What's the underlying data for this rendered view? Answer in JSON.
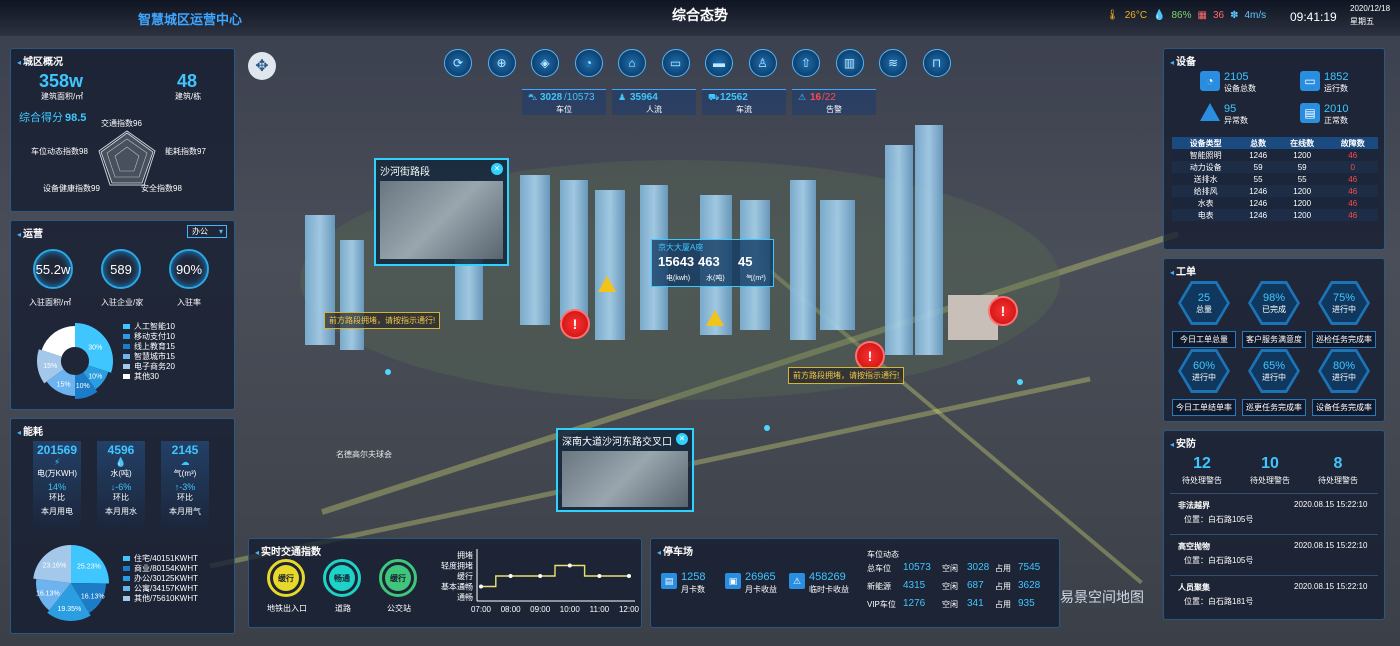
{
  "header": {
    "brand": "智慧城区运营中心",
    "title": "综合态势",
    "temperature": "26°C",
    "humidity": "86%",
    "pm": "36",
    "wind": "4m/s",
    "time": "09:41:19",
    "date": "2020/12/18",
    "weekday": "星期五"
  },
  "overview": {
    "title": "城区概况",
    "area_value": "358w",
    "area_label": "建筑面积/㎡",
    "bldg_value": "48",
    "bldg_label": "建筑/栋",
    "score_label": "综合得分",
    "score_value": "98.5",
    "radar": [
      "交通指数96",
      "能耗指数97",
      "安全指数98",
      "设备健康指数99",
      "车位动态指数98"
    ]
  },
  "ops": {
    "title": "运营",
    "select": "办公",
    "c1": "55.2w",
    "c1_label": "入驻面积/㎡",
    "c2": "589",
    "c2_label": "入驻企业/家",
    "c3": "90%",
    "c3_label": "入驻率",
    "pie_labels": [
      "30%",
      "10%",
      "10%",
      "15%",
      "15%",
      "20%"
    ],
    "legend": [
      "人工智能10",
      "移动支付10",
      "线上教育15",
      "智慧城市15",
      "电子商务20",
      "其他30"
    ],
    "legend_colors": [
      "#3fc6ff",
      "#2a9ee0",
      "#1c7cc8",
      "#6db3ef",
      "#a4c8ea",
      "#ffffff"
    ]
  },
  "energy": {
    "title": "能耗",
    "items": [
      {
        "value": "201569",
        "unit": "电(万KWH)",
        "change": "14%",
        "ratio": "环比",
        "label": "本月用电"
      },
      {
        "value": "4596",
        "unit": "水(吨)",
        "change": "↓-6%",
        "ratio": "环比",
        "label": "本月用水"
      },
      {
        "value": "2145",
        "unit": "气(m³)",
        "change": "↑-3%",
        "ratio": "环比",
        "label": "本月用气"
      }
    ],
    "pie_labels": [
      "25.23%",
      "16.13%",
      "19.35%",
      "16.13%",
      "23.16%"
    ],
    "legend": [
      "住宅/40151KWHT",
      "商业/80154KWHT",
      "办公/30125KWHT",
      "公寓/34157KWHT",
      "其他/75610KWHT"
    ],
    "legend_colors": [
      "#3fc6ff",
      "#1c7cc8",
      "#2a9ee0",
      "#6db3ef",
      "#a4c8ea"
    ]
  },
  "toolbar": {
    "icons": [
      "share-icon",
      "globe-icon",
      "shield-icon",
      "gauge-icon",
      "router-icon",
      "bus-icon",
      "truck-icon",
      "walk-icon",
      "upload-icon",
      "building-icon",
      "chart-icon",
      "bag-icon"
    ],
    "glyphs": [
      "⟳",
      "⊕",
      "◈",
      "◔",
      "⌂",
      "▭",
      "▬",
      "♙",
      "⇧",
      "▥",
      "≋",
      "⊓"
    ]
  },
  "stats": [
    {
      "value": "3028",
      "sub": "/10573",
      "label": "车位"
    },
    {
      "value": "35964",
      "sub": "",
      "label": "人流"
    },
    {
      "value": "12562",
      "sub": "",
      "label": "车流"
    },
    {
      "value": "16",
      "sub": "/22",
      "label": "告警"
    }
  ],
  "scene": {
    "cam1_title": "沙河街路段",
    "cam2_title": "深南大道沙河东路交叉口",
    "building_name": "京大大厦A座",
    "bstats": [
      {
        "value": "15643",
        "label": "电(kwh)"
      },
      {
        "value": "463",
        "label": "水(吨)"
      },
      {
        "value": "45",
        "label": "气(m³)"
      }
    ],
    "msg1": "前方路段拥堵，请按指示通行!",
    "msg2": "前方路段拥堵，请按指示通行!",
    "place_label": "名德高尔夫球会",
    "watermark": "易景空间地图"
  },
  "device": {
    "title": "设备",
    "total": "2105",
    "total_label": "设备总数",
    "running": "1852",
    "running_label": "运行数",
    "abnormal": "95",
    "abnormal_label": "异常数",
    "normal": "2010",
    "normal_label": "正常数",
    "headers": [
      "设备类型",
      "总数",
      "在线数",
      "故障数"
    ],
    "rows": [
      [
        "智能照明",
        "1246",
        "1200",
        "46"
      ],
      [
        "动力设备",
        "59",
        "59",
        "0"
      ],
      [
        "送排水",
        "55",
        "55",
        "46"
      ],
      [
        "给排风",
        "1246",
        "1200",
        "46"
      ],
      [
        "水表",
        "1246",
        "1200",
        "46"
      ],
      [
        "电表",
        "1246",
        "1200",
        "46"
      ]
    ]
  },
  "work": {
    "title": "工单",
    "hexes": [
      {
        "value": "25",
        "label": "总量",
        "caption": "今日工单总量"
      },
      {
        "value": "98%",
        "label": "已完成",
        "caption": "客户服务满意度"
      },
      {
        "value": "75%",
        "label": "进行中",
        "caption": "巡检任务完成率"
      },
      {
        "value": "60%",
        "label": "进行中",
        "caption": "今日工单结单率"
      },
      {
        "value": "65%",
        "label": "进行中",
        "caption": "巡更任务完成率"
      },
      {
        "value": "80%",
        "label": "进行中",
        "caption": "设备任务完成率"
      }
    ]
  },
  "security": {
    "title": "安防",
    "counts": [
      {
        "value": "12",
        "label": "待处理警告"
      },
      {
        "value": "10",
        "label": "待处理警告"
      },
      {
        "value": "8",
        "label": "待处理警告"
      }
    ],
    "events": [
      {
        "name": "非法越界",
        "time": "2020.08.15 15:22:10",
        "pos": "位置：白石路105号"
      },
      {
        "name": "高空抛物",
        "time": "2020.08.15 15:22:10",
        "pos": "位置：白石路105号"
      },
      {
        "name": "人员聚集",
        "time": "2020.08.15 15:22:10",
        "pos": "位置：白石路181号"
      }
    ]
  },
  "traffic": {
    "title": "实时交通指数",
    "rings": [
      {
        "status": "缓行",
        "label": "地铁出入口"
      },
      {
        "status": "畅通",
        "label": "道路"
      },
      {
        "status": "缓行",
        "label": "公交站"
      }
    ]
  },
  "parking": {
    "title": "停车场",
    "items": [
      {
        "value": "1258",
        "label": "月卡数"
      },
      {
        "value": "26965",
        "label": "月卡收益"
      },
      {
        "value": "458269",
        "label": "临时卡收益"
      }
    ],
    "dyn_title": "车位动态",
    "rows": [
      {
        "k": "总车位",
        "v": "10573",
        "k2": "空闲",
        "v2": "3028",
        "k3": "占用",
        "v3": "7545"
      },
      {
        "k": "新能源",
        "v": "4315",
        "k2": "空闲",
        "v2": "687",
        "k3": "占用",
        "v3": "3628"
      },
      {
        "k": "VIP车位",
        "v": "1276",
        "k2": "空闲",
        "v2": "341",
        "k3": "占用",
        "v3": "935"
      }
    ]
  },
  "chart_data": {
    "type": "line",
    "x": [
      "07:00",
      "08:00",
      "09:00",
      "10:00",
      "11:00",
      "12:00"
    ],
    "y_categories": [
      "拥堵",
      "轻度拥堵",
      "缓行",
      "基本通畅",
      "通畅"
    ],
    "series": [
      {
        "values": [
          "基本通畅",
          "缓行",
          "缓行",
          "轻度拥堵",
          "缓行",
          "缓行"
        ]
      }
    ]
  }
}
